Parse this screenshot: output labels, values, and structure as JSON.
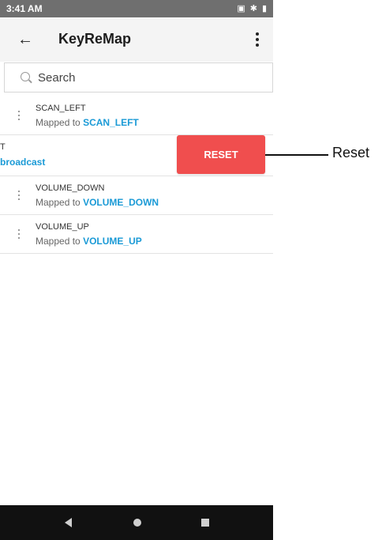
{
  "status_bar": {
    "time": "3:41 AM",
    "icons": [
      "sim-icon",
      "bluetooth-icon",
      "battery-icon"
    ]
  },
  "app_bar": {
    "title": "KeyReMap",
    "back_icon": "arrow-back-icon",
    "menu_icon": "more-vertical-icon"
  },
  "search": {
    "placeholder": "Search"
  },
  "items": [
    {
      "name": "SCAN_LEFT",
      "mapped_prefix": "Mapped to",
      "mapped_target": "SCAN_LEFT"
    },
    {
      "name": "VOLUME_DOWN",
      "mapped_prefix": "Mapped to",
      "mapped_target": "VOLUME_DOWN"
    },
    {
      "name": "VOLUME_UP",
      "mapped_prefix": "Mapped to",
      "mapped_target": "VOLUME_UP"
    }
  ],
  "swiped_item": {
    "name_fragment": "T",
    "mapping_fragment": "broadcast",
    "reset_label": "RESET"
  },
  "callout": {
    "label": "Reset"
  },
  "colors": {
    "accent": "#1a9ad6",
    "reset": "#f04e4e",
    "status_bar": "#6f6f6f",
    "nav_bar": "#111111"
  }
}
